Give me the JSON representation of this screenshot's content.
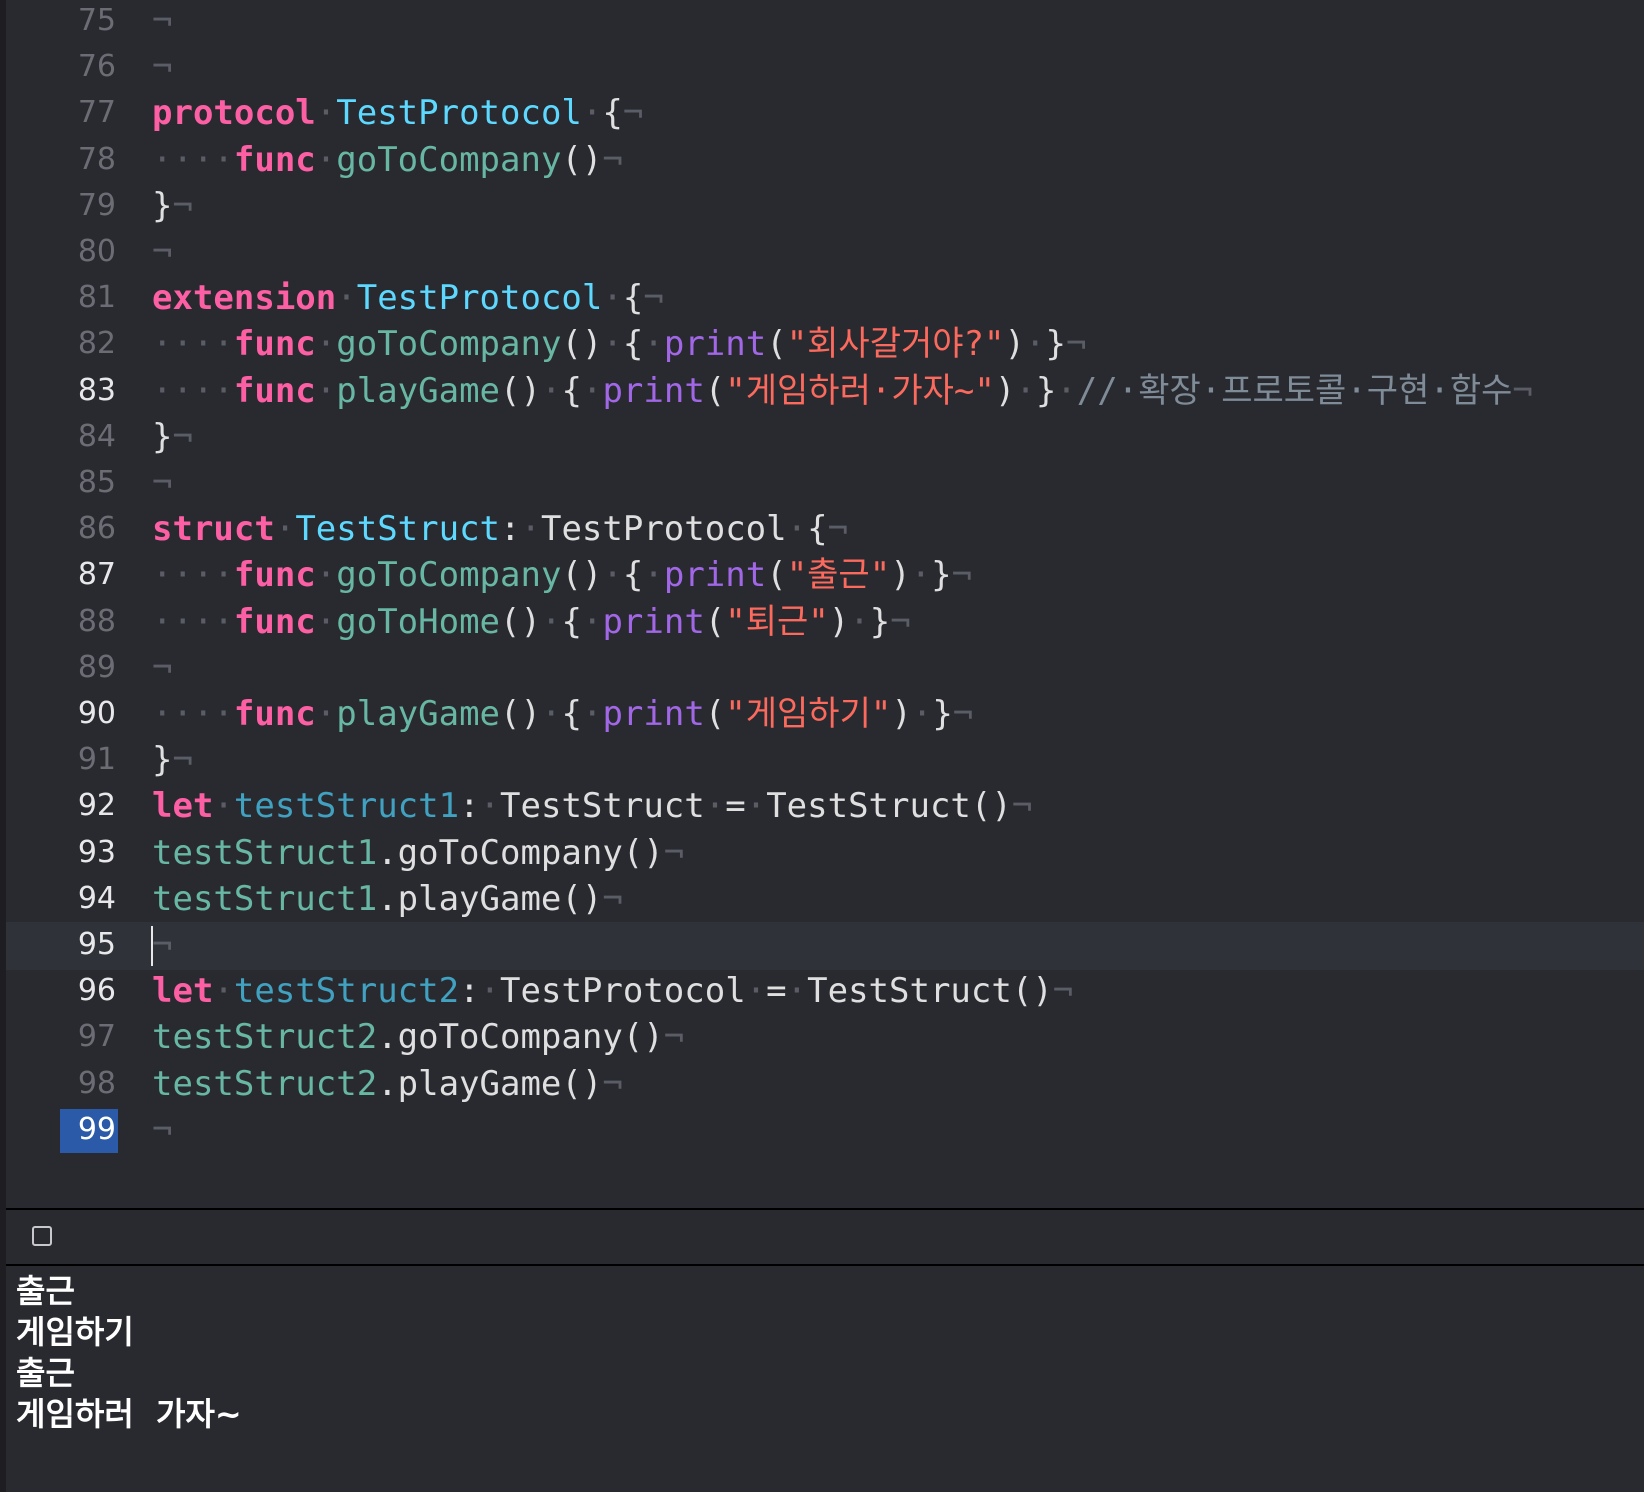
{
  "editor": {
    "lines": [
      {
        "num": "75",
        "tokens": [
          {
            "t": "¬",
            "c": "inv"
          }
        ]
      },
      {
        "num": "76",
        "tokens": [
          {
            "t": "¬",
            "c": "inv"
          }
        ]
      },
      {
        "num": "77",
        "tokens": [
          {
            "t": "protocol",
            "c": "kw"
          },
          {
            "t": "·",
            "c": "ws"
          },
          {
            "t": "TestProtocol",
            "c": "type"
          },
          {
            "t": "·",
            "c": "ws"
          },
          {
            "t": "{",
            "c": "plain"
          },
          {
            "t": "¬",
            "c": "inv"
          }
        ]
      },
      {
        "num": "78",
        "tokens": [
          {
            "t": "····",
            "c": "ws"
          },
          {
            "t": "func",
            "c": "kw"
          },
          {
            "t": "·",
            "c": "ws"
          },
          {
            "t": "goToCompany",
            "c": "fn"
          },
          {
            "t": "()",
            "c": "plain"
          },
          {
            "t": "¬",
            "c": "inv"
          }
        ]
      },
      {
        "num": "79",
        "tokens": [
          {
            "t": "}",
            "c": "plain"
          },
          {
            "t": "¬",
            "c": "inv"
          }
        ]
      },
      {
        "num": "80",
        "tokens": [
          {
            "t": "¬",
            "c": "inv"
          }
        ]
      },
      {
        "num": "81",
        "tokens": [
          {
            "t": "extension",
            "c": "kw"
          },
          {
            "t": "·",
            "c": "ws"
          },
          {
            "t": "TestProtocol",
            "c": "type"
          },
          {
            "t": "·",
            "c": "ws"
          },
          {
            "t": "{",
            "c": "plain"
          },
          {
            "t": "¬",
            "c": "inv"
          }
        ]
      },
      {
        "num": "82",
        "tokens": [
          {
            "t": "····",
            "c": "ws"
          },
          {
            "t": "func",
            "c": "kw"
          },
          {
            "t": "·",
            "c": "ws"
          },
          {
            "t": "goToCompany",
            "c": "fn"
          },
          {
            "t": "()",
            "c": "plain"
          },
          {
            "t": "·",
            "c": "ws"
          },
          {
            "t": "{",
            "c": "plain"
          },
          {
            "t": "·",
            "c": "ws"
          },
          {
            "t": "print",
            "c": "call"
          },
          {
            "t": "(",
            "c": "plain"
          },
          {
            "t": "\"회사갈거야?\"",
            "c": "str"
          },
          {
            "t": ")",
            "c": "plain"
          },
          {
            "t": "·",
            "c": "ws"
          },
          {
            "t": "}",
            "c": "plain"
          },
          {
            "t": "¬",
            "c": "inv"
          }
        ]
      },
      {
        "num": "83",
        "tokens": [
          {
            "t": "····",
            "c": "ws"
          },
          {
            "t": "func",
            "c": "kw"
          },
          {
            "t": "·",
            "c": "ws"
          },
          {
            "t": "playGame",
            "c": "fn"
          },
          {
            "t": "()",
            "c": "plain"
          },
          {
            "t": "·",
            "c": "ws"
          },
          {
            "t": "{",
            "c": "plain"
          },
          {
            "t": "·",
            "c": "ws"
          },
          {
            "t": "print",
            "c": "call"
          },
          {
            "t": "(",
            "c": "plain"
          },
          {
            "t": "\"게임하러·가자~\"",
            "c": "str"
          },
          {
            "t": ")",
            "c": "plain"
          },
          {
            "t": "·",
            "c": "ws"
          },
          {
            "t": "}",
            "c": "plain"
          },
          {
            "t": "·",
            "c": "ws"
          },
          {
            "t": "//·확장·프로토콜·구현·함수",
            "c": "cmt"
          },
          {
            "t": "¬",
            "c": "inv"
          }
        ]
      },
      {
        "num": "84",
        "tokens": [
          {
            "t": "}",
            "c": "plain"
          },
          {
            "t": "¬",
            "c": "inv"
          }
        ]
      },
      {
        "num": "85",
        "tokens": [
          {
            "t": "¬",
            "c": "inv"
          }
        ]
      },
      {
        "num": "86",
        "tokens": [
          {
            "t": "struct",
            "c": "kw"
          },
          {
            "t": "·",
            "c": "ws"
          },
          {
            "t": "TestStruct",
            "c": "type"
          },
          {
            "t": ":",
            "c": "plain"
          },
          {
            "t": "·",
            "c": "ws"
          },
          {
            "t": "TestProtocol",
            "c": "typeref"
          },
          {
            "t": "·",
            "c": "ws"
          },
          {
            "t": "{",
            "c": "plain"
          },
          {
            "t": "¬",
            "c": "inv"
          }
        ]
      },
      {
        "num": "87",
        "tokens": [
          {
            "t": "····",
            "c": "ws"
          },
          {
            "t": "func",
            "c": "kw"
          },
          {
            "t": "·",
            "c": "ws"
          },
          {
            "t": "goToCompany",
            "c": "fn"
          },
          {
            "t": "()",
            "c": "plain"
          },
          {
            "t": "·",
            "c": "ws"
          },
          {
            "t": "{",
            "c": "plain"
          },
          {
            "t": "·",
            "c": "ws"
          },
          {
            "t": "print",
            "c": "call"
          },
          {
            "t": "(",
            "c": "plain"
          },
          {
            "t": "\"출근\"",
            "c": "str"
          },
          {
            "t": ")",
            "c": "plain"
          },
          {
            "t": "·",
            "c": "ws"
          },
          {
            "t": "}",
            "c": "plain"
          },
          {
            "t": "¬",
            "c": "inv"
          }
        ]
      },
      {
        "num": "88",
        "tokens": [
          {
            "t": "····",
            "c": "ws"
          },
          {
            "t": "func",
            "c": "kw"
          },
          {
            "t": "·",
            "c": "ws"
          },
          {
            "t": "goToHome",
            "c": "fn"
          },
          {
            "t": "()",
            "c": "plain"
          },
          {
            "t": "·",
            "c": "ws"
          },
          {
            "t": "{",
            "c": "plain"
          },
          {
            "t": "·",
            "c": "ws"
          },
          {
            "t": "print",
            "c": "call"
          },
          {
            "t": "(",
            "c": "plain"
          },
          {
            "t": "\"퇴근\"",
            "c": "str"
          },
          {
            "t": ")",
            "c": "plain"
          },
          {
            "t": "·",
            "c": "ws"
          },
          {
            "t": "}",
            "c": "plain"
          },
          {
            "t": "¬",
            "c": "inv"
          }
        ]
      },
      {
        "num": "89",
        "tokens": [
          {
            "t": "¬",
            "c": "inv"
          }
        ]
      },
      {
        "num": "90",
        "tokens": [
          {
            "t": "····",
            "c": "ws"
          },
          {
            "t": "func",
            "c": "kw"
          },
          {
            "t": "·",
            "c": "ws"
          },
          {
            "t": "playGame",
            "c": "fn"
          },
          {
            "t": "()",
            "c": "plain"
          },
          {
            "t": "·",
            "c": "ws"
          },
          {
            "t": "{",
            "c": "plain"
          },
          {
            "t": "·",
            "c": "ws"
          },
          {
            "t": "print",
            "c": "call"
          },
          {
            "t": "(",
            "c": "plain"
          },
          {
            "t": "\"게임하기\"",
            "c": "str"
          },
          {
            "t": ")",
            "c": "plain"
          },
          {
            "t": "·",
            "c": "ws"
          },
          {
            "t": "}",
            "c": "plain"
          },
          {
            "t": "¬",
            "c": "inv"
          }
        ]
      },
      {
        "num": "91",
        "tokens": [
          {
            "t": "}",
            "c": "plain"
          },
          {
            "t": "¬",
            "c": "inv"
          }
        ]
      },
      {
        "num": "92",
        "tokens": [
          {
            "t": "let",
            "c": "kw"
          },
          {
            "t": "·",
            "c": "ws"
          },
          {
            "t": "testStruct1",
            "c": "var"
          },
          {
            "t": ":",
            "c": "plain"
          },
          {
            "t": "·",
            "c": "ws"
          },
          {
            "t": "TestStruct",
            "c": "typeref"
          },
          {
            "t": "·",
            "c": "ws"
          },
          {
            "t": "=",
            "c": "plain"
          },
          {
            "t": "·",
            "c": "ws"
          },
          {
            "t": "TestStruct",
            "c": "typeref"
          },
          {
            "t": "()",
            "c": "plain"
          },
          {
            "t": "¬",
            "c": "inv"
          }
        ]
      },
      {
        "num": "93",
        "tokens": [
          {
            "t": "testStruct1",
            "c": "glob"
          },
          {
            "t": ".goToCompany()",
            "c": "plain"
          },
          {
            "t": "¬",
            "c": "inv"
          }
        ]
      },
      {
        "num": "94",
        "tokens": [
          {
            "t": "testStruct1",
            "c": "glob"
          },
          {
            "t": ".playGame()",
            "c": "plain"
          },
          {
            "t": "¬",
            "c": "inv"
          }
        ]
      },
      {
        "num": "95",
        "tokens": [
          {
            "t": "¬",
            "c": "inv"
          }
        ]
      },
      {
        "num": "96",
        "tokens": [
          {
            "t": "let",
            "c": "kw"
          },
          {
            "t": "·",
            "c": "ws"
          },
          {
            "t": "testStruct2",
            "c": "var"
          },
          {
            "t": ":",
            "c": "plain"
          },
          {
            "t": "·",
            "c": "ws"
          },
          {
            "t": "TestProtocol",
            "c": "typeref"
          },
          {
            "t": "·",
            "c": "ws"
          },
          {
            "t": "=",
            "c": "plain"
          },
          {
            "t": "·",
            "c": "ws"
          },
          {
            "t": "TestStruct",
            "c": "typeref"
          },
          {
            "t": "()",
            "c": "plain"
          },
          {
            "t": "¬",
            "c": "inv"
          }
        ]
      },
      {
        "num": "97",
        "tokens": [
          {
            "t": "testStruct2",
            "c": "glob"
          },
          {
            "t": ".goToCompany()",
            "c": "plain"
          },
          {
            "t": "¬",
            "c": "inv"
          }
        ]
      },
      {
        "num": "98",
        "tokens": [
          {
            "t": "testStruct2",
            "c": "glob"
          },
          {
            "t": ".playGame()",
            "c": "plain"
          },
          {
            "t": "¬",
            "c": "inv"
          }
        ]
      },
      {
        "num": "99",
        "tokens": [
          {
            "t": "¬",
            "c": "inv"
          }
        ]
      }
    ],
    "bright_line_numbers": [
      "83",
      "87",
      "90",
      "92",
      "93",
      "94",
      "95",
      "96"
    ],
    "current_line": "95",
    "badge_line": "99"
  },
  "console": {
    "toggle_icon": "square-outline-icon",
    "output": [
      "출근",
      "게임하기",
      "출근",
      "게임하러  가자~"
    ]
  },
  "colors": {
    "background": "#292a30",
    "keyword": "#fc5fa3",
    "type_declaration": "#5dd8ff",
    "function_declaration": "#67b7a4",
    "call": "#a167e6",
    "string": "#fc6a5d",
    "comment": "#7f8c98",
    "line_badge": "#2b5ba8"
  }
}
